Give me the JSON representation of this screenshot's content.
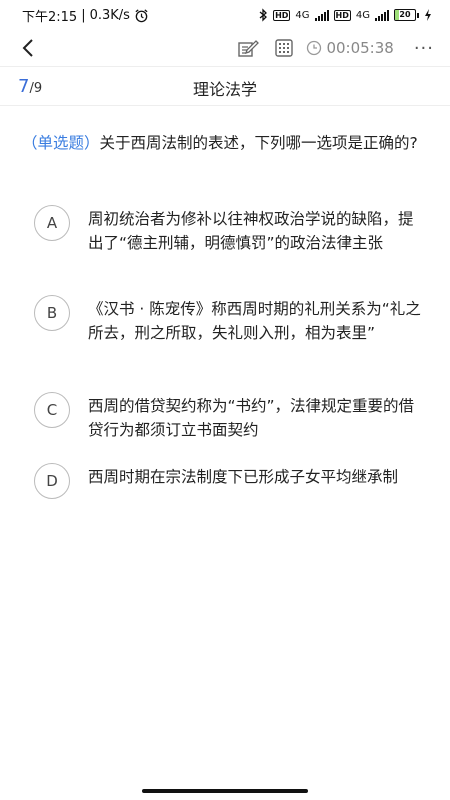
{
  "status_bar": {
    "time": "下午2:15",
    "speed": "0.3K/s",
    "network1": "4G",
    "network2": "4G",
    "battery_level": "20",
    "battery_fraction": 0.2
  },
  "toolbar": {
    "timer": "00:05:38",
    "more": "···"
  },
  "progress": {
    "current": "7",
    "total": "/9"
  },
  "subject_title": "理论法学",
  "question": {
    "type": "（单选题）",
    "text": "关于西周法制的表述，下列哪一选项是正确的?"
  },
  "options": [
    {
      "letter": "A",
      "text": "周初统治者为修补以往神权政治学说的缺陷，提出了“德主刑辅，明德慎罚”的政治法律主张"
    },
    {
      "letter": "B",
      "text": "《汉书 · 陈宠传》称西周时期的礼刑关系为“礼之所去，刑之所取，失礼则入刑，相为表里”"
    },
    {
      "letter": "C",
      "text": "西周的借贷契约称为“书约”，法律规定重要的借贷行为都须订立书面契约"
    },
    {
      "letter": "D",
      "text": "西周时期在宗法制度下已形成子女平均继承制"
    }
  ],
  "colors": {
    "accent": "#3a6dd8",
    "question_type": "#3a7de0"
  }
}
